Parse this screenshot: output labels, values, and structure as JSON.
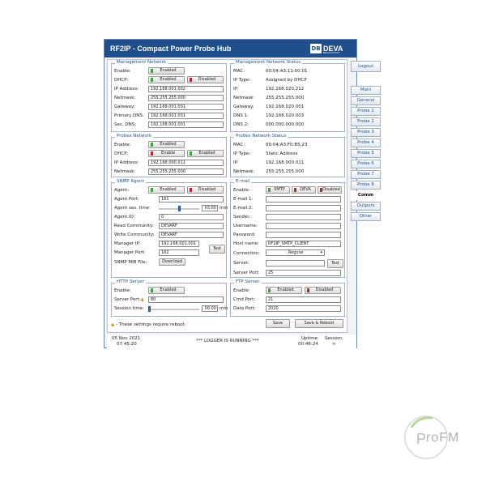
{
  "window": {
    "title": "RF2IP - Compact Power Probe Hub",
    "logo_mark": "DB",
    "logo_text": "DEVA",
    "logo_sub": "BROADCAST"
  },
  "sidebar": {
    "logout": "Logout",
    "items": [
      "Main",
      "General",
      "Probe 1",
      "Probe 2",
      "Probe 3",
      "Probe 4",
      "Probe 5",
      "Probe 6",
      "Probe 7",
      "Probe 8",
      "Comm",
      "Outputs",
      "Other"
    ],
    "active": "Comm"
  },
  "mgmt_network": {
    "title": "Management Network",
    "enable_label": "Enable:",
    "enable_btn": "Enabled",
    "dhcp_label": "DHCP:",
    "dhcp_enabled": "Enabled",
    "dhcp_disabled": "Disabled",
    "ip_label": "IP Address:",
    "ip": "192.168.001.002",
    "netmask_label": "Netmask:",
    "netmask": "255.255.255.000",
    "gateway_label": "Gateway:",
    "gateway": "192.168.001.001",
    "pdns_label": "Primary DNS:",
    "pdns": "192.168.001.001",
    "sdns_label": "Sec. DNS:",
    "sdns": "192.168.001.001"
  },
  "mgmt_status": {
    "title": "Management Network Status",
    "mac_label": "MAC:",
    "mac": "00:04:A3:11:00:01",
    "iptype_label": "IP Type:",
    "iptype": "Assigned by DHCP",
    "ip_label": "IP:",
    "ip": "192.168.020.212",
    "netmask_label": "Netmask:",
    "netmask": "255.255.255.000",
    "gateway_label": "Gateway:",
    "gateway": "192.168.020.001",
    "dns1_label": "DNS 1:",
    "dns1": "192.168.020.003",
    "dns2_label": "DNS 2:",
    "dns2": "000.000.000.000"
  },
  "probes_network": {
    "title": "Probes Network",
    "enable_label": "Enable:",
    "enable_btn": "Enabled",
    "dhcp_label": "DHCP:",
    "dhcp_enable": "Enable",
    "dhcp_enabled": "Enabled",
    "ip_label": "IP Address:",
    "ip": "192.168.000.011",
    "netmask_label": "Netmask:",
    "netmask": "255.255.255.000"
  },
  "probes_status": {
    "title": "Probes Network Status",
    "mac_label": "MAC:",
    "mac": "00:04:A3:F0:B5:23",
    "iptype_label": "IP Type:",
    "iptype": "Static Address",
    "ip_label": "IP:",
    "ip": "192.168.000.011",
    "netmask_label": "Netmask:",
    "netmask": "255.255.255.000"
  },
  "snmp": {
    "title": "SNMP Agent",
    "agent_label": "Agent:",
    "enabled": "Enabled",
    "disabled": "Disabled",
    "port_label": "Agent Port:",
    "port": "161",
    "ses_label": "Agent ses. time:",
    "ses_value": "03:00",
    "ses_unit": "min",
    "id_label": "Agent ID:",
    "id": "0",
    "read_label": "Read Community:",
    "read": "DEVARF",
    "write_label": "Write Community:",
    "write": "DEVARF",
    "mip_label": "Manager IP:",
    "mip": "192.168.001.001",
    "mport_label": "Manager Port:",
    "mport": "162",
    "mib_label": "SNMP MIB File:",
    "download": "Download",
    "test": "Test"
  },
  "email": {
    "title": "E-mail",
    "enable_label": "Enable:",
    "smtp": "SMTP",
    "deva": "DEVA",
    "disabled": "Disabled",
    "e1_label": "E-mail 1:",
    "e2_label": "E-mail 2:",
    "sender_label": "Sender:",
    "user_label": "Username:",
    "pass_label": "Password:",
    "host_label": "Host name:",
    "host": "RF2IP_SMTP_CLIENT",
    "conn_label": "Connection:",
    "conn": "Regular",
    "server_label": "Server:",
    "sport_label": "Server Port:",
    "sport": "25",
    "test": "Test"
  },
  "http": {
    "title": "HTTP Server",
    "enable_label": "Enable:",
    "enabled": "Enabled",
    "port_label": "Server Port:",
    "port": "80",
    "ses_label": "Session time:",
    "ses_value": "00:00",
    "ses_unit": "min"
  },
  "ftp": {
    "title": "FTP Server",
    "enable_label": "Enable:",
    "enabled": "Enabled",
    "disabled": "Disabled",
    "cmd_label": "Cmd Port:",
    "cmd": "21",
    "data_label": "Data Port:",
    "data": "2020"
  },
  "actions": {
    "save": "Save",
    "save_reboot": "Save & Reboot",
    "reboot_note": "- These settings require reboot."
  },
  "footer": {
    "date": "05 Nov 2021",
    "time": "07:45:20",
    "logger": "*** LOGGER IS RUNNING ***",
    "uptime_label": "Uptime:",
    "uptime": "00:46:24",
    "session_label": "Session:",
    "session": "∞"
  },
  "watermark": {
    "text": "roFM"
  },
  "colors": {
    "header": "#1f4f8c",
    "led_on": "#3ca33c",
    "led_off": "#b12a2a"
  }
}
